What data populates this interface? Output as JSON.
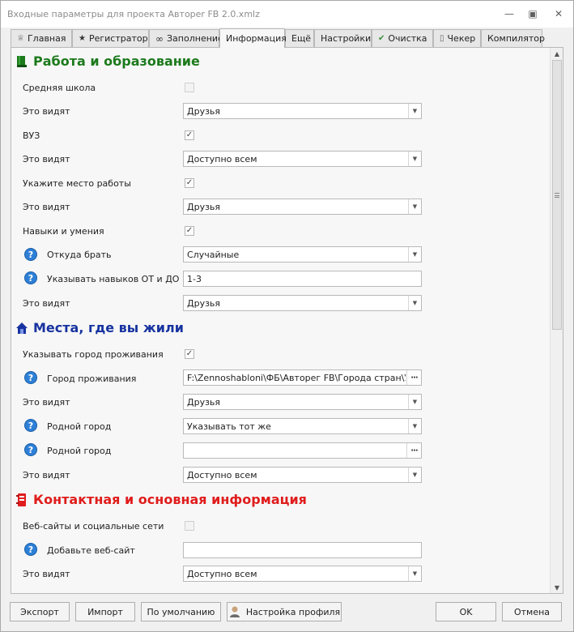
{
  "window": {
    "title": "Входные параметры для проекта Автореr FB 2.0.xmlz"
  },
  "tabs": [
    {
      "label": "Главная",
      "icon": "crown-icon"
    },
    {
      "label": "Регистратор",
      "icon": "star-icon"
    },
    {
      "label": "Заполнение",
      "icon": "infinity-icon"
    },
    {
      "label": "Информация",
      "icon": "",
      "active": true
    },
    {
      "label": "Ещё",
      "icon": ""
    },
    {
      "label": "Настройки",
      "icon": ""
    },
    {
      "label": "Очистка",
      "icon": "check-icon"
    },
    {
      "label": "Чекер",
      "icon": "phone-icon"
    },
    {
      "label": "Компилятор",
      "icon": ""
    }
  ],
  "sections": {
    "work": {
      "title": "Работа и образование",
      "color": "#1c7a1c"
    },
    "places": {
      "title": "Места, где вы жили",
      "color": "#1733a0"
    },
    "contact": {
      "title": "Контактная и основная информация",
      "color": "#e01c1c"
    }
  },
  "rows": {
    "school_label": "Средняя школа",
    "school_checked": false,
    "school_visibility_label": "Это видят",
    "school_visibility": "Друзья",
    "university_label": "ВУЗ",
    "university_checked": true,
    "university_visibility_label": "Это видят",
    "university_visibility": "Доступно всем",
    "work_label": "Укажите место работы",
    "work_checked": true,
    "work_visibility_label": "Это видят",
    "work_visibility": "Друзья",
    "skills_label": "Навыки и умения",
    "skills_checked": true,
    "skills_source_label": "Откуда брать",
    "skills_source": "Случайные",
    "skills_range_label": "Указывать навыков ОТ и ДО",
    "skills_range": "1-3",
    "skills_visibility_label": "Это видят",
    "skills_visibility": "Друзья",
    "city_flag_label": "Указывать город проживания",
    "city_flag_checked": true,
    "city_label": "Город проживания",
    "city_path": "F:\\Zennoshabloni\\ФБ\\Авторег FB\\Города стран\\Украи",
    "city_visibility_label": "Это видят",
    "city_visibility": "Друзья",
    "hometown_mode_label": "Родной город",
    "hometown_mode": "Указывать тот же",
    "hometown_label": "Родной город",
    "hometown_path": "",
    "hometown_visibility_label": "Это видят",
    "hometown_visibility": "Доступно всем",
    "websites_label": "Веб-сайты и социальные сети",
    "websites_checked": false,
    "add_website_label": "Добавьте веб-сайт",
    "add_website_value": "",
    "websites_visibility_label": "Это видят",
    "websites_visibility": "Доступно всем"
  },
  "buttons": {
    "export": "Экспорт",
    "import": "Импорт",
    "defaults": "По умолчанию",
    "profile_settings": "Настройка профиля",
    "ok": "OK",
    "cancel": "Отмена"
  }
}
